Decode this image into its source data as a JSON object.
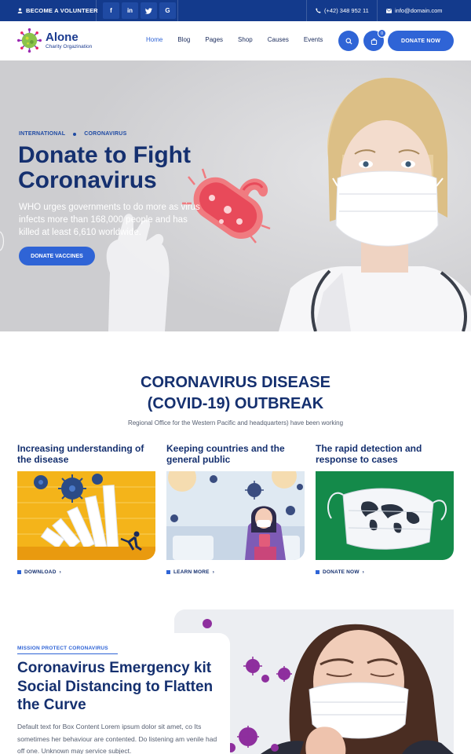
{
  "topbar": {
    "volunteer": "BECOME A VOLUNTEER",
    "social": [
      {
        "icon": "facebook-icon",
        "glyph": "f"
      },
      {
        "icon": "linkedin-icon",
        "glyph": "in"
      },
      {
        "icon": "twitter-icon",
        "glyph": "t"
      },
      {
        "icon": "google-icon",
        "glyph": "G"
      }
    ],
    "phone": "(+42) 348 952 11",
    "email": "info@domain.com"
  },
  "header": {
    "logo_title": "Alone",
    "logo_subtitle": "Charity Orgazination",
    "nav": [
      "Home",
      "Blog",
      "Pages",
      "Shop",
      "Causes",
      "Events"
    ],
    "active_nav": "Home",
    "cart_count": "0",
    "donate_label": "DONATE NOW"
  },
  "hero": {
    "tag1": "INTERNATIONAL",
    "tag2": "CORONAVIRUS",
    "title_line1": "Donate to Fight",
    "title_line2": "Coronavirus",
    "description": "WHO urges governments to do more as virus infects more than 168,000 people and has killed at least 6,610 worldwide.",
    "button": "DONATE VACCINES"
  },
  "section": {
    "title_line1": "CORONAVIRUS DISEASE",
    "title_line2": "(COVID-19) OUTBREAK",
    "subtitle": "Regional Office for the Western Pacific and headquarters) have been working"
  },
  "cards": [
    {
      "title": "Increasing understanding of the disease",
      "link": "DOWNLOAD"
    },
    {
      "title": "Keeping countries and the general public",
      "link": "LEARN MORE"
    },
    {
      "title": "The rapid detection and response to cases",
      "link": "DONATE NOW"
    }
  ],
  "mission": {
    "tag": "MISSION PROTECT CORONAVIRUS",
    "title": "Coronavirus Emergency kit Social Distancing to Flatten the Curve",
    "text": "Default text for Box Content Lorem ipsum dolor sit amet, co Its sometimes her behaviour are contented. Do listening am venile had off one. Unknown may service subject."
  },
  "colors": {
    "primary": "#2f64d6",
    "topbar": "#133a8c",
    "heading": "#15306f"
  }
}
